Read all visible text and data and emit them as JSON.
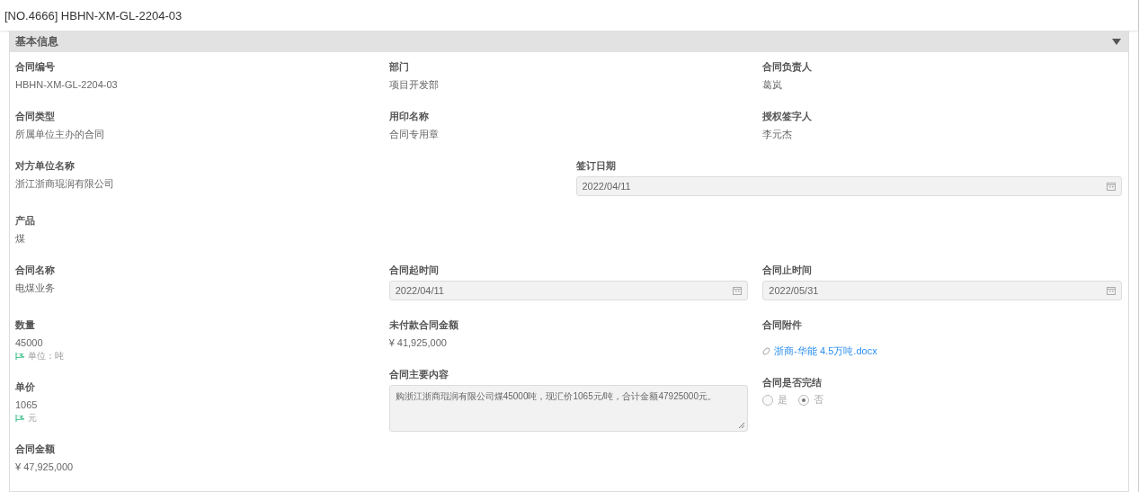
{
  "title": "[NO.4666] HBHN-XM-GL-2204-03",
  "section": {
    "title": "基本信息",
    "expanded": true
  },
  "rows": [
    {
      "kind": "thirds",
      "fields": [
        {
          "label": "合同编号",
          "kind": "text",
          "value": "HBHN-XM-GL-2204-03"
        },
        {
          "label": "部门",
          "kind": "text",
          "value": "项目开发部"
        },
        {
          "label": "合同负责人",
          "kind": "text",
          "value": "葛岚"
        }
      ]
    },
    {
      "kind": "thirds",
      "fields": [
        {
          "label": "合同类型",
          "kind": "text",
          "value": "所属单位主办的合同"
        },
        {
          "label": "用印名称",
          "kind": "text",
          "value": "合同专用章"
        },
        {
          "label": "授权签字人",
          "kind": "text",
          "value": "李元杰"
        }
      ]
    },
    {
      "kind": "halves",
      "fields": [
        {
          "label": "对方单位名称",
          "kind": "text",
          "value": "浙江浙商琨润有限公司"
        },
        {
          "label": "签订日期",
          "kind": "date",
          "value": "2022/04/11"
        }
      ]
    },
    {
      "kind": "thirds",
      "fields": [
        {
          "label": "产品",
          "kind": "text",
          "value": "煤"
        }
      ]
    },
    {
      "kind": "thirds",
      "fields": [
        {
          "label": "合同名称",
          "kind": "text",
          "value": "电煤业务"
        },
        {
          "label": "合同起时间",
          "kind": "date",
          "value": "2022/04/11"
        },
        {
          "label": "合同止时间",
          "kind": "date",
          "value": "2022/05/31"
        }
      ]
    },
    {
      "kind": "stacks",
      "columns": [
        [
          {
            "label": "数量",
            "kind": "text",
            "value": "45000",
            "note": "单位：吨"
          },
          {
            "label": "单价",
            "kind": "text",
            "value": "1065",
            "note": "元"
          },
          {
            "label": "合同金额",
            "kind": "text",
            "value": "¥ 47,925,000"
          }
        ],
        [
          {
            "label": "未付款合同金额",
            "kind": "text",
            "value": "¥ 41,925,000"
          },
          {
            "label": "合同主要内容",
            "kind": "textarea",
            "value": "购浙江浙商琨润有限公司煤45000吨，现汇价1065元/吨，合计金额47925000元。"
          }
        ],
        [
          {
            "label": "合同附件",
            "kind": "attachment",
            "value": "浙商-华能 4.5万吨.docx"
          },
          {
            "label": "合同是否完结",
            "kind": "radio",
            "options": [
              {
                "label": "是",
                "selected": false
              },
              {
                "label": "否",
                "selected": true
              }
            ]
          }
        ]
      ]
    }
  ]
}
